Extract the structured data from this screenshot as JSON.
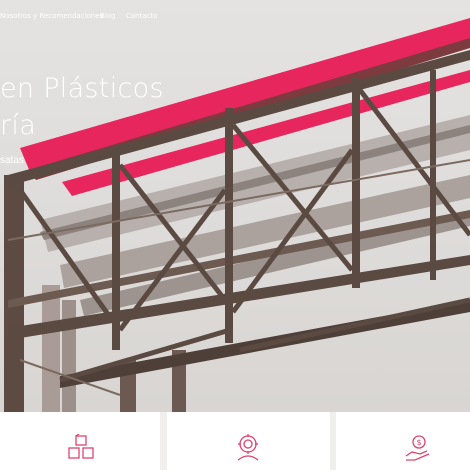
{
  "nav": {
    "items": [
      {
        "label": "Nosotros y Recomendaciones"
      },
      {
        "label": "Blog"
      },
      {
        "label": "Contacto"
      }
    ]
  },
  "hero": {
    "title_line1": "en Plásticos",
    "title_line2": "ría",
    "subtitle": "satas"
  },
  "features": [
    {
      "icon": "cubes-icon"
    },
    {
      "icon": "gear-flower-icon"
    },
    {
      "icon": "hand-coin-icon"
    }
  ],
  "colors": {
    "accent": "#e8265e",
    "steel": "#5a4a42",
    "pipe": "#b6aeaa",
    "icon": "#e0436e"
  }
}
